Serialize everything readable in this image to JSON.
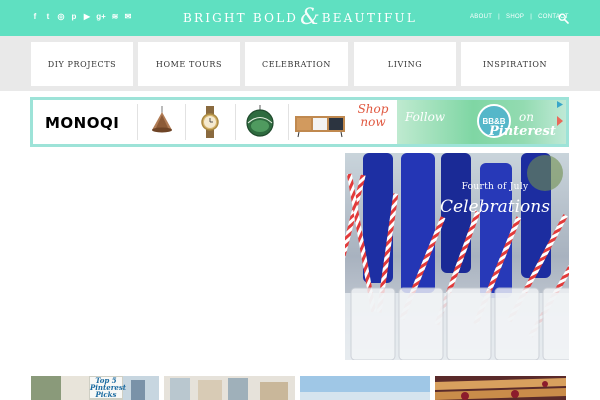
{
  "header": {
    "brand_left": "BRIGHT BOLD",
    "brand_amp": "&",
    "brand_right": "BEAUTIFUL",
    "social_icons": [
      "facebook-icon",
      "twitter-icon",
      "instagram-icon",
      "pinterest-icon",
      "youtube-icon",
      "google-plus-icon",
      "rss-icon",
      "email-icon"
    ],
    "social_glyphs": [
      "f",
      "t",
      "◎",
      "p",
      "▶",
      "g+",
      "≋",
      "✉"
    ],
    "links": [
      {
        "label": "ABOUT"
      },
      {
        "label": "SHOP"
      },
      {
        "label": "CONTACT"
      }
    ],
    "separator": "|",
    "accent_color": "#5fe0c1"
  },
  "nav": {
    "categories": [
      {
        "label": "DIY PROJECTS"
      },
      {
        "label": "HOME TOURS"
      },
      {
        "label": "CELEBRATION"
      },
      {
        "label": "LIVING"
      },
      {
        "label": "INSPIRATION"
      }
    ]
  },
  "ad": {
    "brand": "MONOQI",
    "shop_now": "Shop now",
    "follow": "Follow",
    "badge": "BB&B",
    "on": "on",
    "pinterest": "Pinterest"
  },
  "hero": {
    "title": "Fourth of July",
    "subtitle": "Celebrations"
  },
  "thumbnails": {
    "first_label": "Top 5 Pinterest Picks"
  }
}
